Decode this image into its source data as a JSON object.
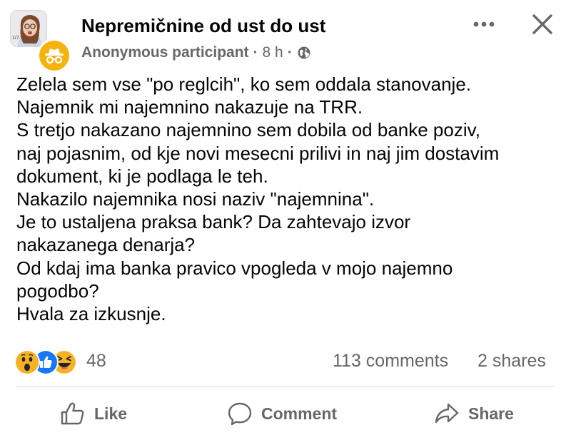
{
  "post": {
    "group_name": "Nepremičnine od ust do ust",
    "author": "Anonymous participant",
    "separator": "·",
    "time": "8 h",
    "text_lines": [
      "Zelela sem vse \"po reglcih\", ko sem oddala stanovanje.",
      "Najemnik mi najemnino nakazuje na TRR.",
      "S tretjo nakazano najemnino sem dobila od banke poziv,",
      "naj pojasnim, od kje novi mesecni prilivi in naj jim dostavim",
      "dokument, ki je podlaga le teh.",
      "Nakazilo najemnika nosi naziv \"najemnina\".",
      "Je to ustaljena praksa bank? Da zahtevajo izvor",
      "nakazanega denarja?",
      "Od kdaj ima banka pravico vpogleda v mojo najemno",
      "pogodbo?",
      "Hvala za izkusnje."
    ]
  },
  "thumb_text": "1/7",
  "stats": {
    "reactions_count": "48",
    "reactions": [
      "wow",
      "like",
      "haha"
    ],
    "comments": "113 comments",
    "shares": "2 shares"
  },
  "actions": {
    "like": "Like",
    "comment": "Comment",
    "share": "Share"
  },
  "icons": {
    "globe": "globe-icon",
    "more": "more-options-icon",
    "close": "close-icon",
    "incognito": "incognito-icon"
  },
  "colors": {
    "text": "#050505",
    "secondary": "#65676b",
    "like_blue": "#1877f2",
    "reaction_yellow": "#f7b125",
    "incognito_badge": "#f6b20f",
    "divider": "#d8dadf"
  }
}
